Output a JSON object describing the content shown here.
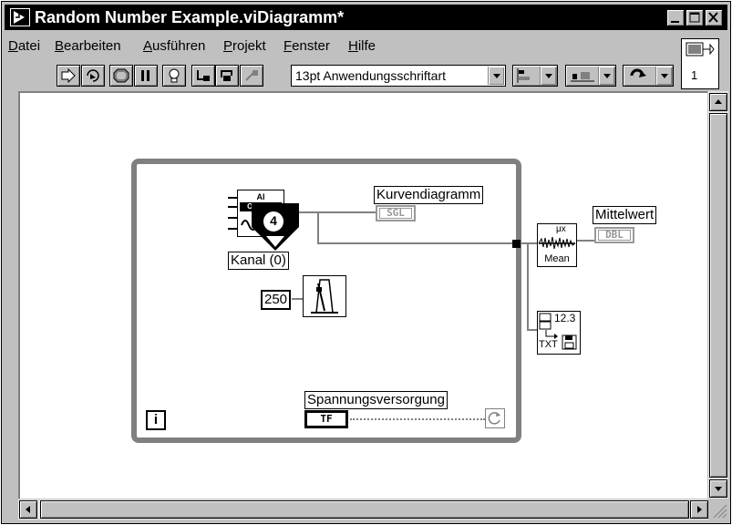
{
  "window": {
    "title": "Random Number Example.viDiagramm*",
    "controls": {
      "minimize": "_",
      "maximize": "□",
      "close": "✕"
    }
  },
  "menu": {
    "items": [
      "Datei",
      "Bearbeiten",
      "Ausführen",
      "Projekt",
      "Fenster",
      "Hilfe"
    ],
    "mnemonics": [
      "D",
      "B",
      "A",
      "P",
      "F",
      "H"
    ]
  },
  "toolbar": {
    "font_select": "13pt Anwendungsschriftart",
    "context_help_number": "1",
    "buttons": [
      "run-arrow-icon",
      "run-continuously-icon",
      "abort-icon",
      "pause-icon",
      "highlight-execution-icon",
      "retain-wire-values-icon",
      "step-into-icon",
      "step-over-icon",
      "step-out-icon"
    ]
  },
  "diagram": {
    "callout_number": "4",
    "daq_vi": {
      "line1": "AI",
      "line2": "ONE PT"
    },
    "channel_label": "Kanal (0)",
    "waveform_chart_label": "Kurvendiagramm",
    "waveform_chart_type": "SGL",
    "mean_label": "Mittelwert",
    "mean_type": "DBL",
    "mean_vi_text": "Mean",
    "mean_vi_symbol": "μx",
    "constant_value": "250",
    "write_file_vi": {
      "top": "12.3",
      "bottom": "TXT"
    },
    "power_label": "Spannungsversorgung",
    "power_type": "TF",
    "iteration_terminal": "i"
  }
}
